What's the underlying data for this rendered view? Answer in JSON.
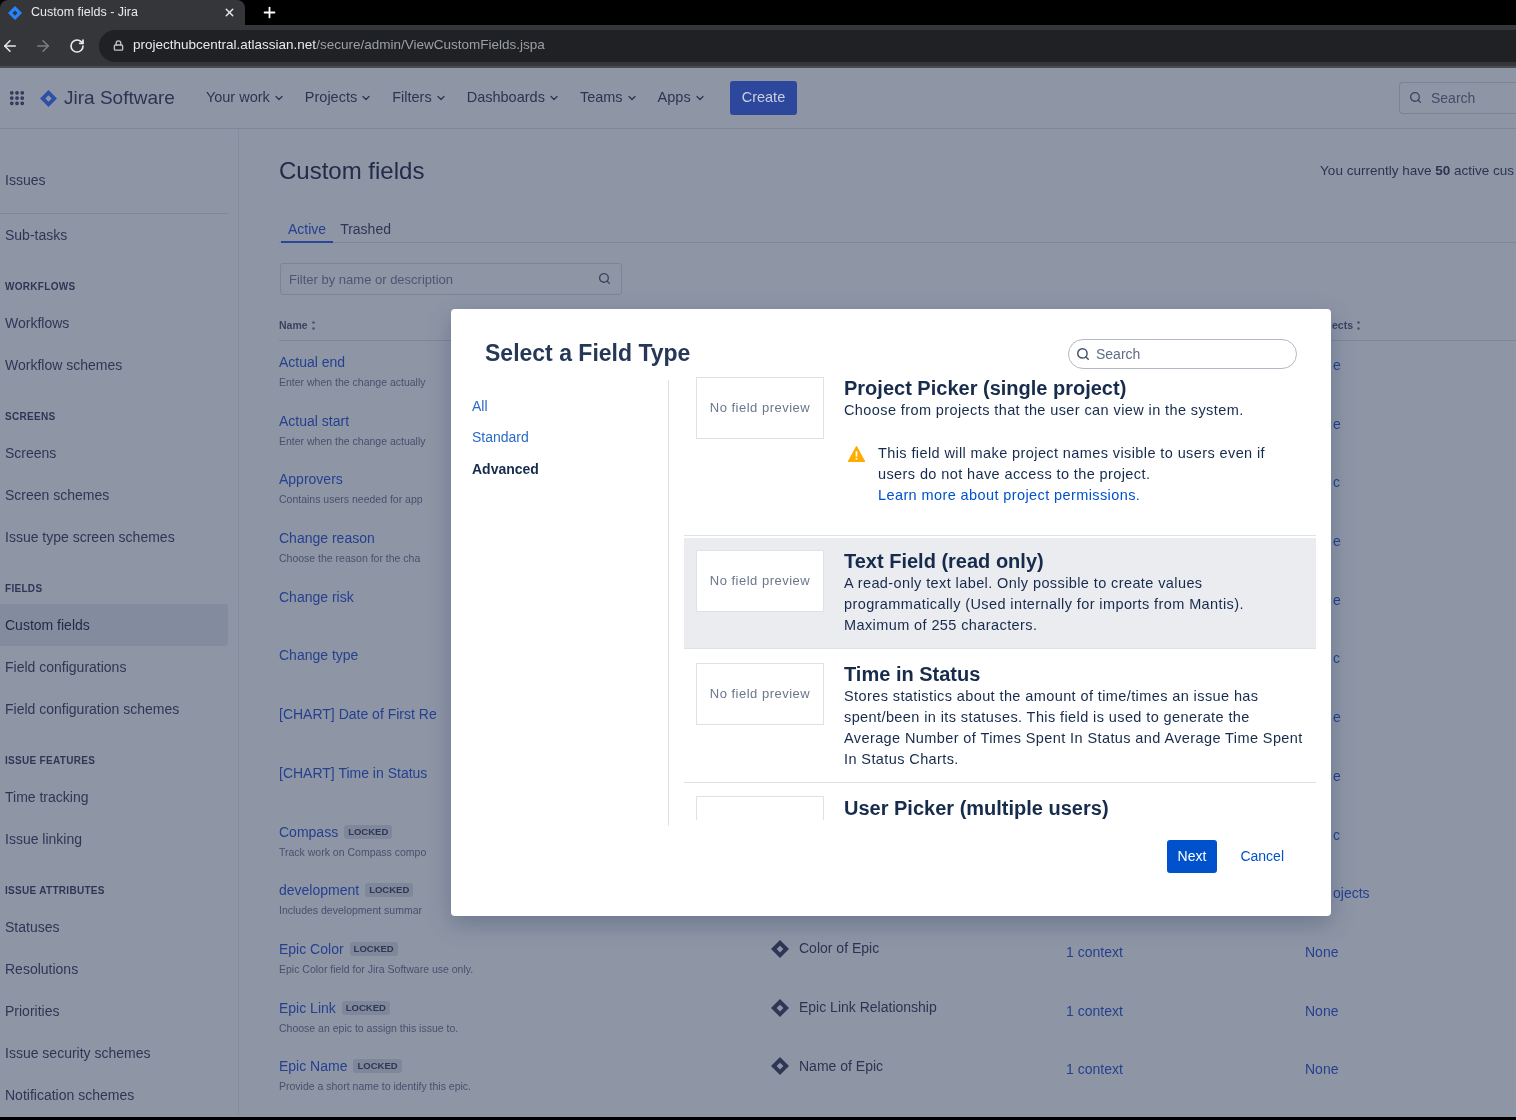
{
  "browser": {
    "tab_title": "Custom fields - Jira",
    "url": {
      "host": "projecthubcentral.atlassian.net",
      "path": "/secure/admin/ViewCustomFields.jspa"
    }
  },
  "top_nav": {
    "product": "Jira Software",
    "menus": [
      "Your work",
      "Projects",
      "Filters",
      "Dashboards",
      "Teams",
      "Apps"
    ],
    "create_button": "Create",
    "search": {
      "placeholder": "Search"
    }
  },
  "sidebar": {
    "top_items": [
      {
        "label": "Issues",
        "selected": false
      }
    ],
    "items": [
      {
        "label": "Sub-tasks",
        "selected": false
      }
    ],
    "sections": [
      {
        "heading": "WORKFLOWS",
        "items": [
          {
            "label": "Workflows",
            "selected": false
          },
          {
            "label": "Workflow schemes",
            "selected": false
          }
        ]
      },
      {
        "heading": "SCREENS",
        "items": [
          {
            "label": "Screens",
            "selected": false
          },
          {
            "label": "Screen schemes",
            "selected": false
          },
          {
            "label": "Issue type screen schemes",
            "selected": false
          }
        ]
      },
      {
        "heading": "FIELDS",
        "items": [
          {
            "label": "Custom fields",
            "selected": true
          },
          {
            "label": "Field configurations",
            "selected": false
          },
          {
            "label": "Field configuration schemes",
            "selected": false
          }
        ]
      },
      {
        "heading": "ISSUE FEATURES",
        "items": [
          {
            "label": "Time tracking",
            "selected": false
          },
          {
            "label": "Issue linking",
            "selected": false
          }
        ]
      },
      {
        "heading": "ISSUE ATTRIBUTES",
        "items": [
          {
            "label": "Statuses",
            "selected": false
          },
          {
            "label": "Resolutions",
            "selected": false
          },
          {
            "label": "Priorities",
            "selected": false
          },
          {
            "label": "Issue security schemes",
            "selected": false
          },
          {
            "label": "Notification schemes",
            "selected": false
          }
        ]
      }
    ]
  },
  "page": {
    "title": "Custom fields",
    "summary": "You currently have **50** active cus",
    "tabs": [
      {
        "label": "Active",
        "selected": true
      },
      {
        "label": "Trashed",
        "selected": false
      }
    ],
    "filter": {
      "placeholder": "Filter by name or description"
    }
  },
  "table": {
    "header": {
      "name": "Name",
      "column_4": "ects"
    },
    "rows": [
      {
        "name": "Actual end",
        "description": "Enter when the change actually",
        "column_4": "e"
      },
      {
        "name": "Actual start",
        "description": "Enter when the change actually",
        "column_4": "e"
      },
      {
        "name": "Approvers",
        "description": "Contains users needed for app",
        "column_4": "c"
      },
      {
        "name": "Change reason",
        "description": "Choose the reason for the cha",
        "column_4": "e"
      },
      {
        "name": "Change risk",
        "column_4": "e"
      },
      {
        "name": "Change type",
        "column_4": "c"
      },
      {
        "name": "[CHART] Date of First Re",
        "column_4": "e"
      },
      {
        "name": "[CHART] Time in Status",
        "column_4": "e"
      },
      {
        "name": "Compass",
        "badge": "LOCKED",
        "description": "Track work on Compass compo",
        "column_4": "c"
      },
      {
        "name": "development",
        "badge": "LOCKED",
        "description": "Includes development summar",
        "column_4": "ojects"
      },
      {
        "name": "Epic Color",
        "badge": "LOCKED",
        "description": "Epic Color field for Jira Software use only.",
        "type": "Color of Epic",
        "contexts": "1 context",
        "column_4": "None"
      },
      {
        "name": "Epic Link",
        "badge": "LOCKED",
        "description": "Choose an epic to assign this issue to.",
        "type": "Epic Link Relationship",
        "contexts": "1 context",
        "column_4": "None"
      },
      {
        "name": "Epic Name",
        "badge": "LOCKED",
        "description": "Provide a short name to identify this epic.",
        "type": "Name of Epic",
        "contexts": "1 context",
        "column_4": "None"
      }
    ]
  },
  "modal": {
    "title": "Select a Field Type",
    "search": {
      "placeholder": "Search"
    },
    "categories": [
      {
        "label": "All",
        "selected": false
      },
      {
        "label": "Standard",
        "selected": false
      },
      {
        "label": "Advanced",
        "selected": true
      }
    ],
    "field_types": [
      {
        "name": "Project Picker (single project)",
        "preview": "No field preview",
        "description": "Choose from projects that the user can view in the system.",
        "warning": {
          "text": "This field will make project names visible to users even if users do not have access to the project.",
          "link": "Learn more about project permissions."
        },
        "selected": false
      },
      {
        "name": "Text Field (read only)",
        "preview": "No field preview",
        "description": "A read-only text label. Only possible to create values programmatically (Used internally for imports from Mantis). Maximum of 255 characters.",
        "selected": true
      },
      {
        "name": "Time in Status",
        "preview": "No field preview",
        "description": "Stores statistics about the amount of time/times an issue has spent/been in its statuses. This field is used to generate the Average Number of Times Spent In Status and Average Time Spent In Status Charts.",
        "selected": false
      },
      {
        "name": "User Picker (multiple users)",
        "selected": false
      }
    ],
    "next_button": "Next",
    "cancel_button": "Cancel"
  }
}
